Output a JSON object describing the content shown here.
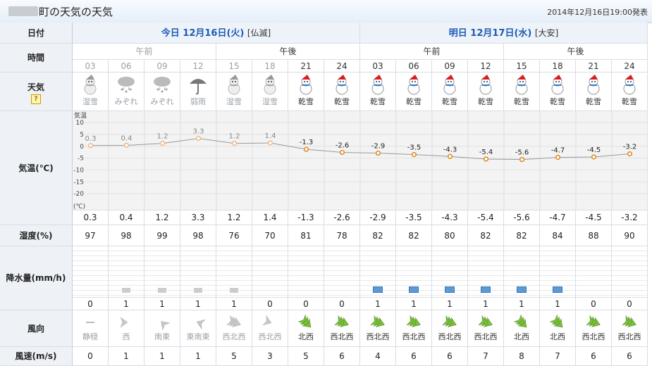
{
  "header": {
    "title": "町の天気",
    "issued": "2014年12月16日19:00発表"
  },
  "labels": {
    "date": "日付",
    "time": "時間",
    "weather": "天気",
    "weather_help": "?",
    "temperature": "気温(℃)",
    "humidity": "湿度(%)",
    "precip": "降水量(mm/h)",
    "wind_dir": "風向",
    "wind_speed": "風速(m/s)"
  },
  "days": [
    {
      "label": "今日 12月16日(火)",
      "rokuyo": "[仏滅]"
    },
    {
      "label": "明日 12月17日(水)",
      "rokuyo": "[大安]"
    }
  ],
  "periods": [
    "午前",
    "午後",
    "午前",
    "午後"
  ],
  "hours": [
    "03",
    "06",
    "09",
    "12",
    "15",
    "18",
    "21",
    "24",
    "03",
    "06",
    "09",
    "12",
    "15",
    "18",
    "21",
    "24"
  ],
  "weather": [
    "湿雪",
    "みぞれ",
    "みぞれ",
    "弱雨",
    "湿雪",
    "湿雪",
    "乾雪",
    "乾雪",
    "乾雪",
    "乾雪",
    "乾雪",
    "乾雪",
    "乾雪",
    "乾雪",
    "乾雪",
    "乾雪"
  ],
  "temps": [
    "0.3",
    "0.4",
    "1.2",
    "3.3",
    "1.2",
    "1.4",
    "-1.3",
    "-2.6",
    "-2.9",
    "-3.5",
    "-4.3",
    "-5.4",
    "-5.6",
    "-4.7",
    "-4.5",
    "-3.2"
  ],
  "chart_data": {
    "type": "line",
    "x": [
      "03",
      "06",
      "09",
      "12",
      "15",
      "18",
      "21",
      "24",
      "03",
      "06",
      "09",
      "12",
      "15",
      "18",
      "21",
      "24"
    ],
    "values": [
      0.3,
      0.4,
      1.2,
      3.3,
      1.2,
      1.4,
      -1.3,
      -2.6,
      -2.9,
      -3.5,
      -4.3,
      -5.4,
      -5.6,
      -4.7,
      -4.5,
      -3.2
    ],
    "ylabel": "気温",
    "yunit": "(℃)",
    "yticks": [
      "10",
      "5",
      "0",
      "-5",
      "-10",
      "-15",
      "-20"
    ],
    "ylim": [
      -25,
      13
    ],
    "grid": true
  },
  "humidity": [
    "97",
    "98",
    "99",
    "98",
    "76",
    "70",
    "81",
    "78",
    "82",
    "82",
    "80",
    "82",
    "82",
    "84",
    "88",
    "90"
  ],
  "precip": [
    "0",
    "1",
    "1",
    "1",
    "1",
    "0",
    "0",
    "0",
    "1",
    "1",
    "1",
    "1",
    "1",
    "1",
    "0",
    "0"
  ],
  "wind_dir": [
    "静穏",
    "西",
    "南東",
    "東南東",
    "西北西",
    "西北西",
    "北西",
    "西北西",
    "西北西",
    "西北西",
    "西北西",
    "西北西",
    "北西",
    "北西",
    "西北西",
    "西北西"
  ],
  "wind_speed": [
    "0",
    "1",
    "1",
    "1",
    "5",
    "3",
    "5",
    "6",
    "4",
    "6",
    "6",
    "7",
    "8",
    "7",
    "6",
    "6"
  ],
  "colors": {
    "day_header": "#1d5cb5",
    "past_text": "#9aa0a6",
    "temp_line": "#999999",
    "temp_marker": "#e08a1e",
    "precip_bar": "#5b9bd5",
    "past_bar": "#cccccc",
    "wind_arrow": "#7bbf3c",
    "past_arrow": "#c8c8c8"
  }
}
